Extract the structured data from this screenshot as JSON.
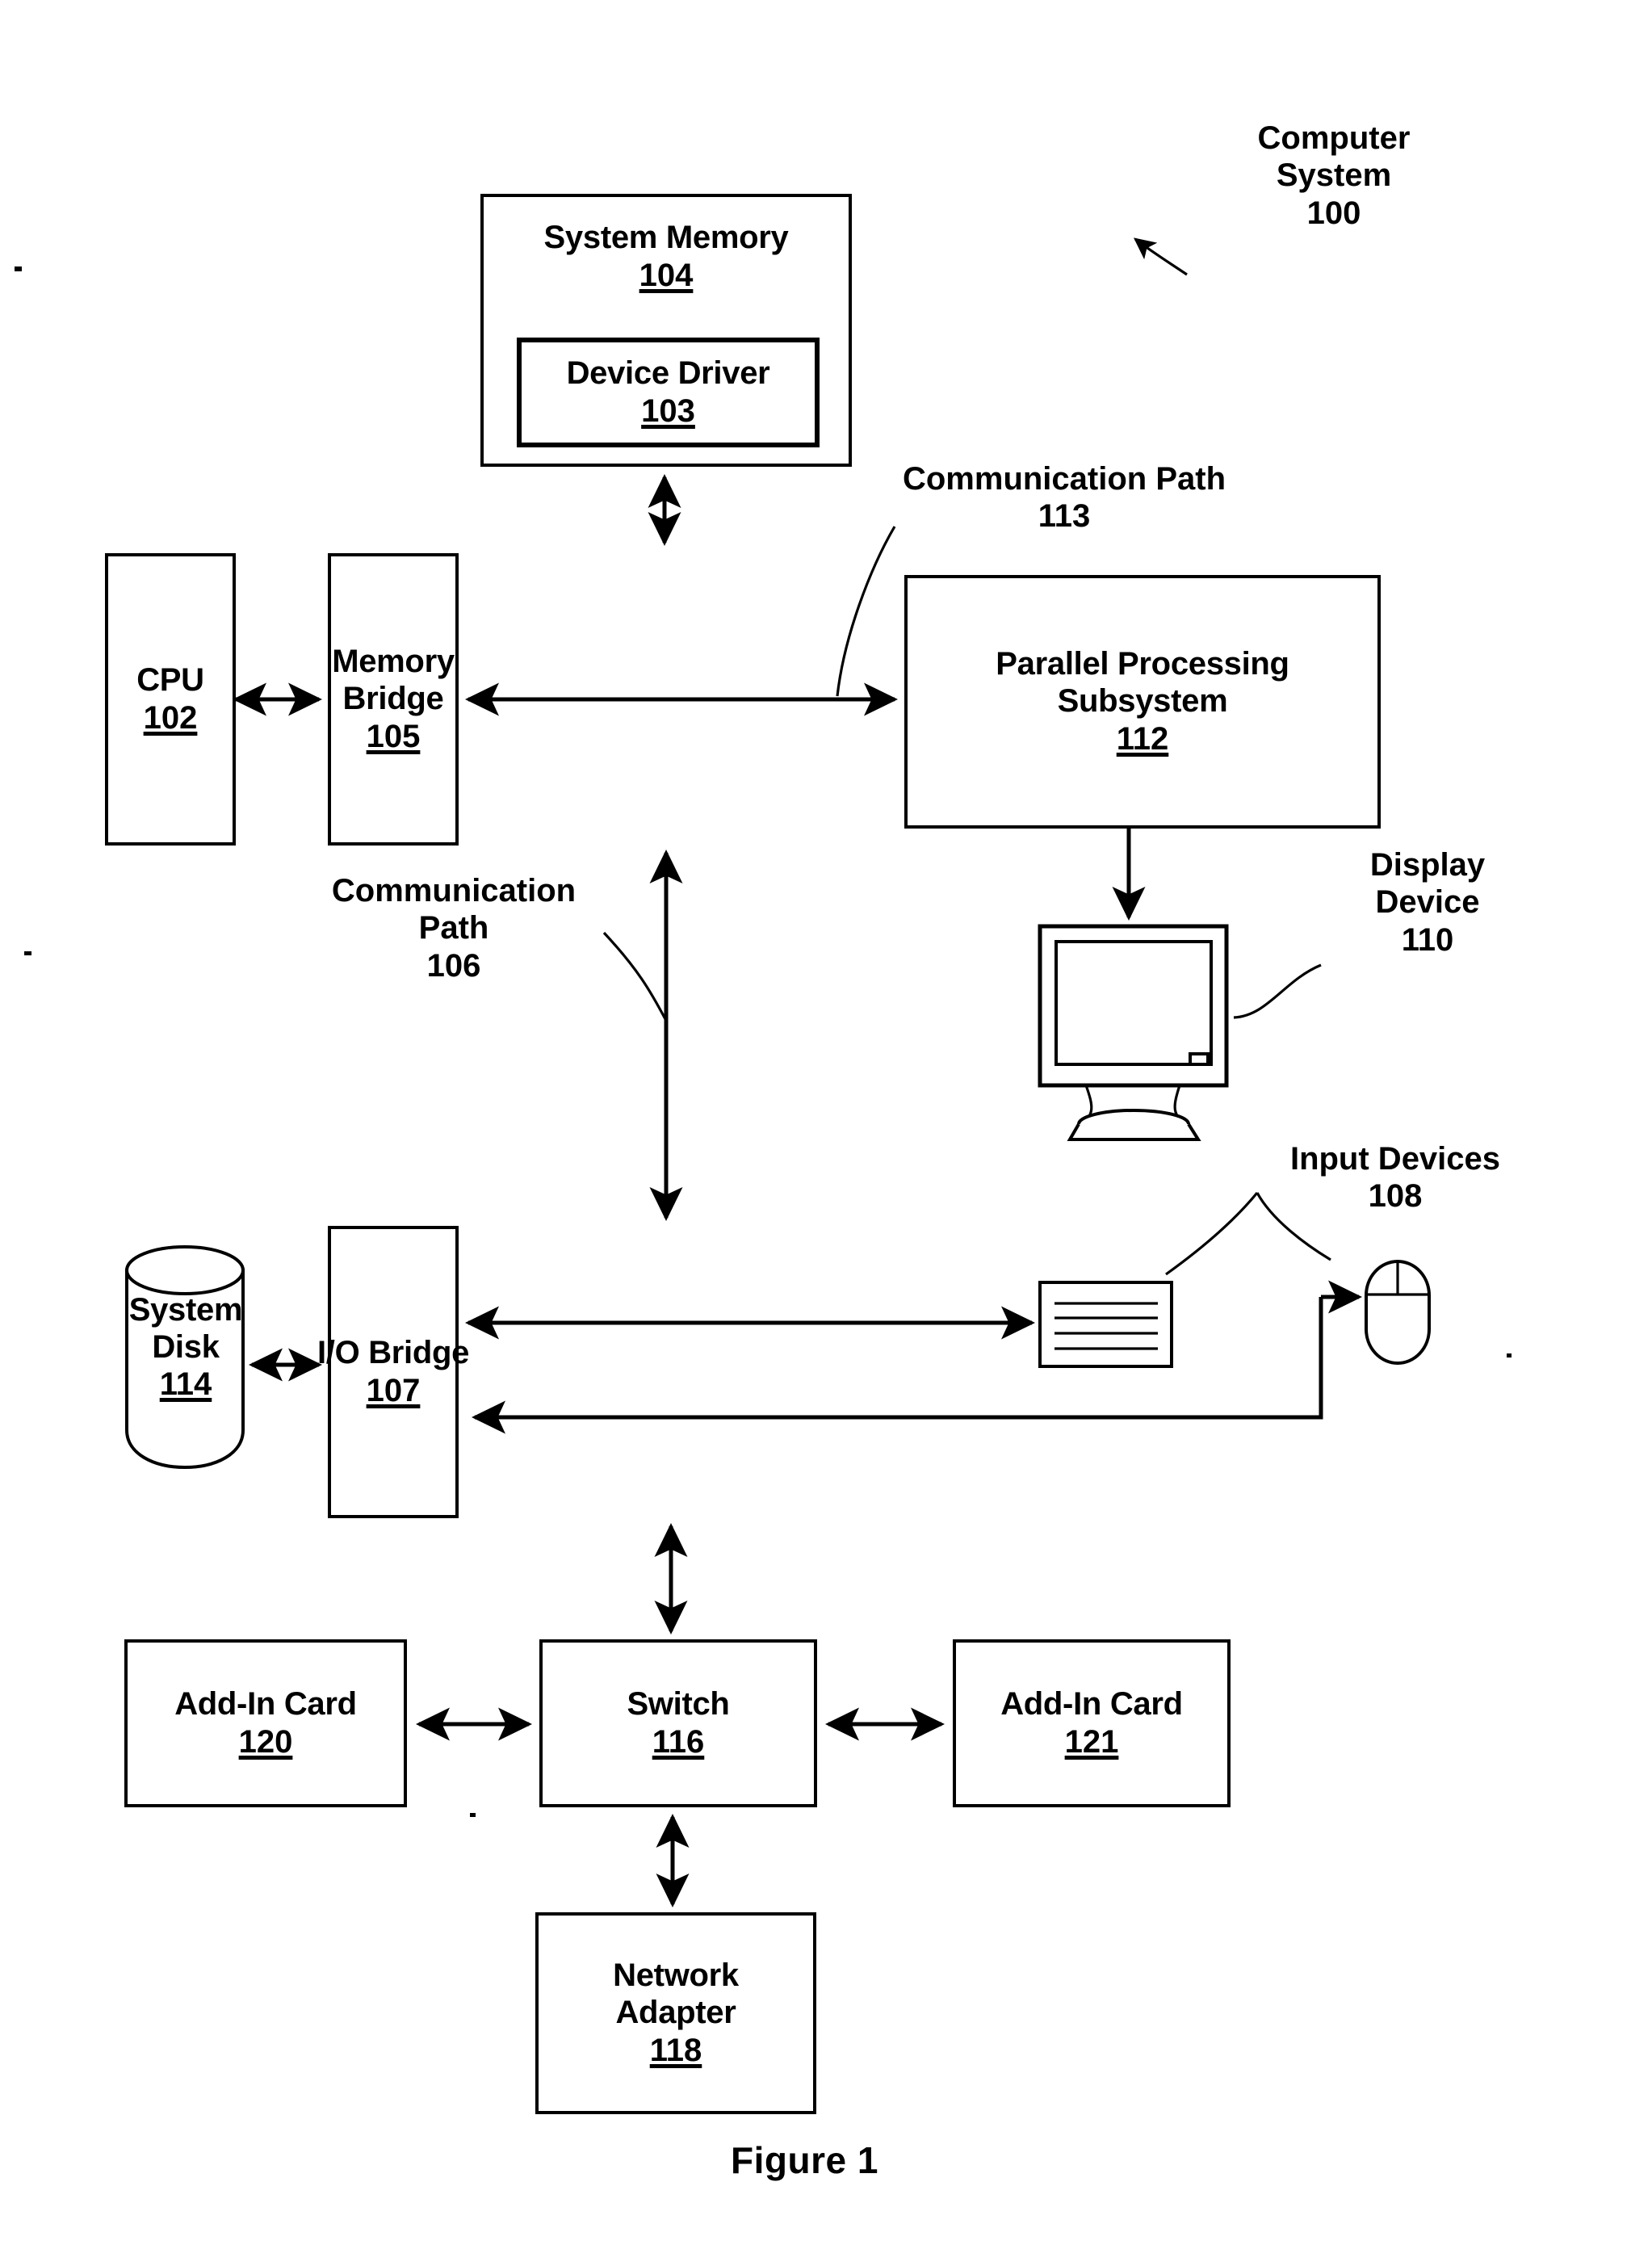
{
  "figure": {
    "caption": "Figure 1",
    "system_label": "Computer System",
    "system_number": "100"
  },
  "blocks": [
    {
      "id": "system-memory",
      "label": "System Memory",
      "number": "104"
    },
    {
      "id": "device-driver",
      "label": "Device Driver",
      "number": "103"
    },
    {
      "id": "cpu",
      "label": "CPU",
      "number": "102"
    },
    {
      "id": "memory-bridge",
      "label": "Memory\nBridge",
      "number": "105"
    },
    {
      "id": "parallel-proc",
      "label": "Parallel Processing\nSubsystem",
      "number": "112"
    },
    {
      "id": "io-bridge",
      "label": "I/O Bridge",
      "number": "107"
    },
    {
      "id": "system-disk",
      "label": "System\nDisk",
      "number": "114"
    },
    {
      "id": "add-in-card-120",
      "label": "Add-In Card",
      "number": "120"
    },
    {
      "id": "switch",
      "label": "Switch",
      "number": "116"
    },
    {
      "id": "add-in-card-121",
      "label": "Add-In Card",
      "number": "121"
    },
    {
      "id": "network-adapter",
      "label": "Network\nAdapter",
      "number": "118"
    }
  ],
  "block_text": {
    "system_memory_label": "System Memory",
    "system_memory_number": "104",
    "device_driver_label": "Device Driver",
    "device_driver_number": "103",
    "cpu_label": "CPU",
    "cpu_number": "102",
    "memory_bridge_line1": "Memory",
    "memory_bridge_line2": "Bridge",
    "memory_bridge_number": "105",
    "parallel_line1": "Parallel Processing",
    "parallel_line2": "Subsystem",
    "parallel_number": "112",
    "io_bridge_label": "I/O Bridge",
    "io_bridge_number": "107",
    "system_disk_line1": "System",
    "system_disk_line2": "Disk",
    "system_disk_number": "114",
    "add_in_card_120_label": "Add-In Card",
    "add_in_card_120_number": "120",
    "switch_label": "Switch",
    "switch_number": "116",
    "add_in_card_121_label": "Add-In Card",
    "add_in_card_121_number": "121",
    "network_adapter_line1": "Network",
    "network_adapter_line2": "Adapter",
    "network_adapter_number": "118"
  },
  "annotations": {
    "computer_system": "Computer\nSystem\n100",
    "comm_path_113": "Communication Path\n113",
    "comm_path_106": "Communication\nPath\n106",
    "display_device": "Display\nDevice\n110",
    "input_devices": "Input Devices\n108"
  },
  "icons": {
    "display": "display-device-icon",
    "keyboard": "keyboard-icon",
    "mouse": "mouse-icon",
    "disk": "cylinder-disk-icon"
  },
  "colors": {
    "ink": "#000000",
    "paper": "#ffffff"
  }
}
